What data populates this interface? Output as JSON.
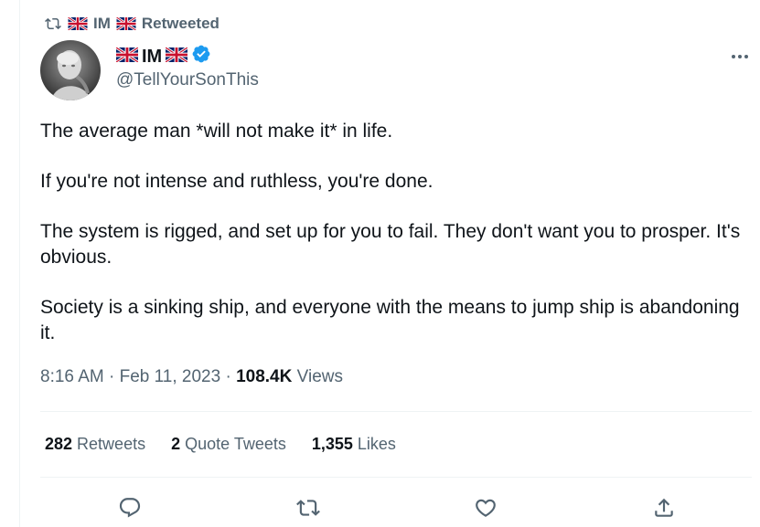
{
  "retweet_header": {
    "retweeter": "IM",
    "label": "Retweeted"
  },
  "author": {
    "display_name": "IM",
    "handle": "@TellYourSonThis",
    "verified": true
  },
  "tweet": {
    "paragraphs": [
      "The average man *will not make it* in life.",
      "If you're not intense and ruthless, you're done.",
      "The system is rigged, and set up for you to fail. They don't want you to prosper. It's obvious.",
      "Society is a sinking ship, and everyone with the means to jump ship is abandoning it."
    ]
  },
  "meta": {
    "time": "8:16 AM",
    "separator": "·",
    "date": "Feb 11, 2023",
    "views_count": "108.4K",
    "views_label": "Views"
  },
  "stats": {
    "retweets_count": "282",
    "retweets_label": "Retweets",
    "quotes_count": "2",
    "quotes_label": "Quote Tweets",
    "likes_count": "1,355",
    "likes_label": "Likes"
  },
  "icons": {
    "retweet": "retweet-icon",
    "flag": "uk-flag-icon",
    "verified": "verified-badge-icon",
    "more": "more-icon",
    "reply": "reply-icon",
    "like": "like-icon",
    "share": "share-icon"
  },
  "colors": {
    "text_primary": "#0f1419",
    "text_secondary": "#536471",
    "verified_blue": "#1d9bf0",
    "divider": "#eff3f4"
  }
}
